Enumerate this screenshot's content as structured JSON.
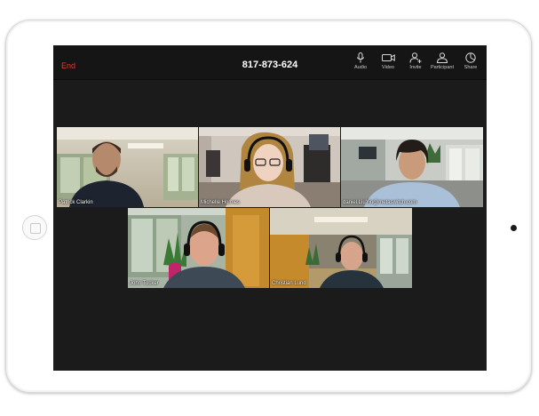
{
  "meeting": {
    "end_label": "End",
    "meeting_id": "817-873-624"
  },
  "toolbar": [
    {
      "label": "Audio",
      "icon": "microphone-icon"
    },
    {
      "label": "Video",
      "icon": "video-camera-icon"
    },
    {
      "label": "Invite",
      "icon": "invite-user-icon"
    },
    {
      "label": "Participant",
      "icon": "participants-icon"
    },
    {
      "label": "Share",
      "icon": "share-icon"
    }
  ],
  "participants": [
    {
      "name": "Patrick Clarkin"
    },
    {
      "name": "Michelle Holmes"
    },
    {
      "name": "daniel.LiuYin@metaswitch.com"
    },
    {
      "name": "John Tucker"
    },
    {
      "name": "Christian Lund"
    }
  ],
  "colors": {
    "end": "#e23b2e",
    "screen_bg": "#1b1b1b",
    "toolbar_bg": "#151515"
  }
}
